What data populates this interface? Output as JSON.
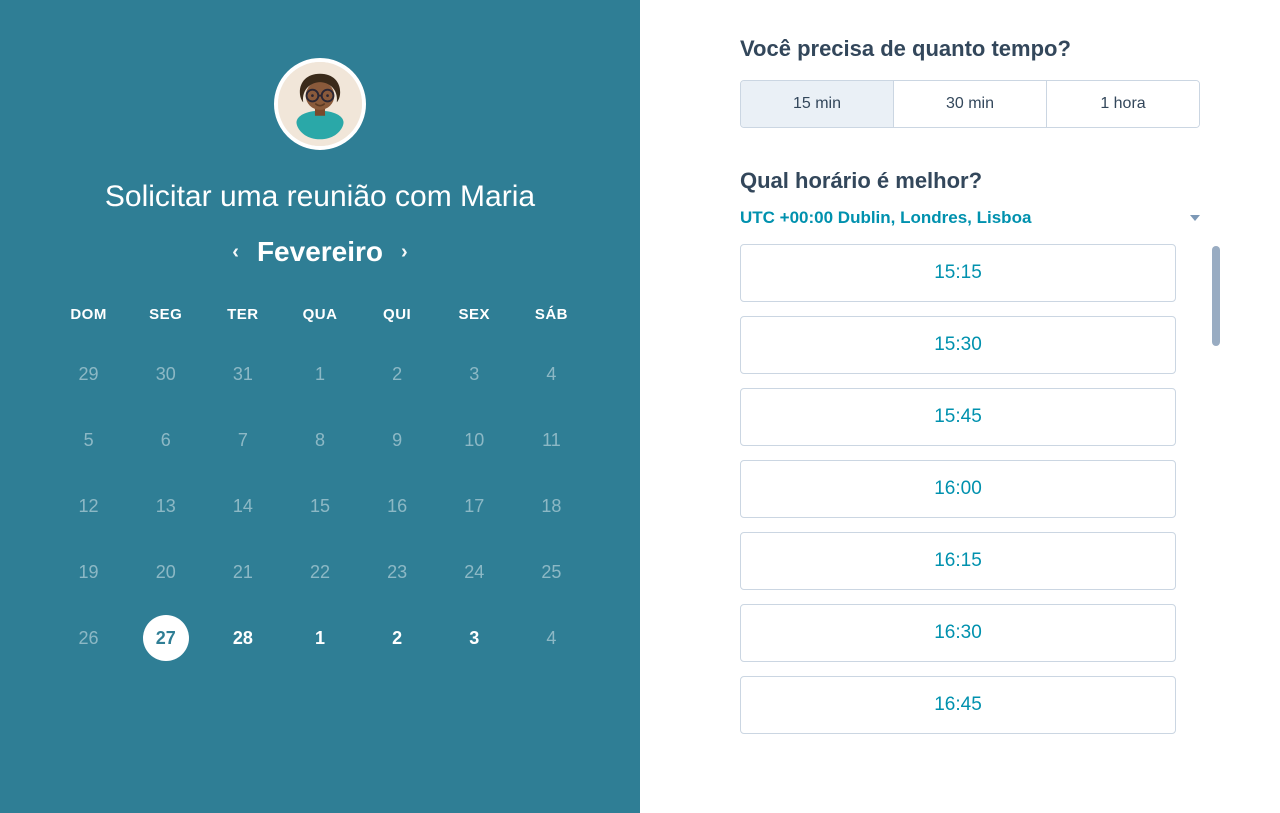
{
  "left": {
    "title": "Solicitar uma reunião com Maria",
    "month": "Fevereiro",
    "day_headers": [
      "DOM",
      "SEG",
      "TER",
      "QUA",
      "QUI",
      "SEX",
      "SÁB"
    ],
    "weeks": [
      [
        {
          "n": "29",
          "state": "dim"
        },
        {
          "n": "30",
          "state": "dim"
        },
        {
          "n": "31",
          "state": "dim"
        },
        {
          "n": "1",
          "state": "dim"
        },
        {
          "n": "2",
          "state": "dim"
        },
        {
          "n": "3",
          "state": "dim"
        },
        {
          "n": "4",
          "state": "dim"
        }
      ],
      [
        {
          "n": "5",
          "state": "dim"
        },
        {
          "n": "6",
          "state": "dim"
        },
        {
          "n": "7",
          "state": "dim"
        },
        {
          "n": "8",
          "state": "dim"
        },
        {
          "n": "9",
          "state": "dim"
        },
        {
          "n": "10",
          "state": "dim"
        },
        {
          "n": "11",
          "state": "dim"
        }
      ],
      [
        {
          "n": "12",
          "state": "dim"
        },
        {
          "n": "13",
          "state": "dim"
        },
        {
          "n": "14",
          "state": "dim"
        },
        {
          "n": "15",
          "state": "dim"
        },
        {
          "n": "16",
          "state": "dim"
        },
        {
          "n": "17",
          "state": "dim"
        },
        {
          "n": "18",
          "state": "dim"
        }
      ],
      [
        {
          "n": "19",
          "state": "dim"
        },
        {
          "n": "20",
          "state": "dim"
        },
        {
          "n": "21",
          "state": "dim"
        },
        {
          "n": "22",
          "state": "dim"
        },
        {
          "n": "23",
          "state": "dim"
        },
        {
          "n": "24",
          "state": "dim"
        },
        {
          "n": "25",
          "state": "dim"
        }
      ],
      [
        {
          "n": "26",
          "state": "dim"
        },
        {
          "n": "27",
          "state": "selected"
        },
        {
          "n": "28",
          "state": "bold"
        },
        {
          "n": "1",
          "state": "bold"
        },
        {
          "n": "2",
          "state": "bold"
        },
        {
          "n": "3",
          "state": "bold"
        },
        {
          "n": "4",
          "state": "dim"
        }
      ]
    ]
  },
  "right": {
    "q_duration": "Você precisa de quanto tempo?",
    "durations": [
      {
        "label": "15 min",
        "active": true
      },
      {
        "label": "30 min",
        "active": false
      },
      {
        "label": "1 hora",
        "active": false
      }
    ],
    "q_time": "Qual horário é melhor?",
    "timezone": "UTC +00:00 Dublin, Londres, Lisboa",
    "slots": [
      "15:15",
      "15:30",
      "15:45",
      "16:00",
      "16:15",
      "16:30",
      "16:45"
    ]
  }
}
